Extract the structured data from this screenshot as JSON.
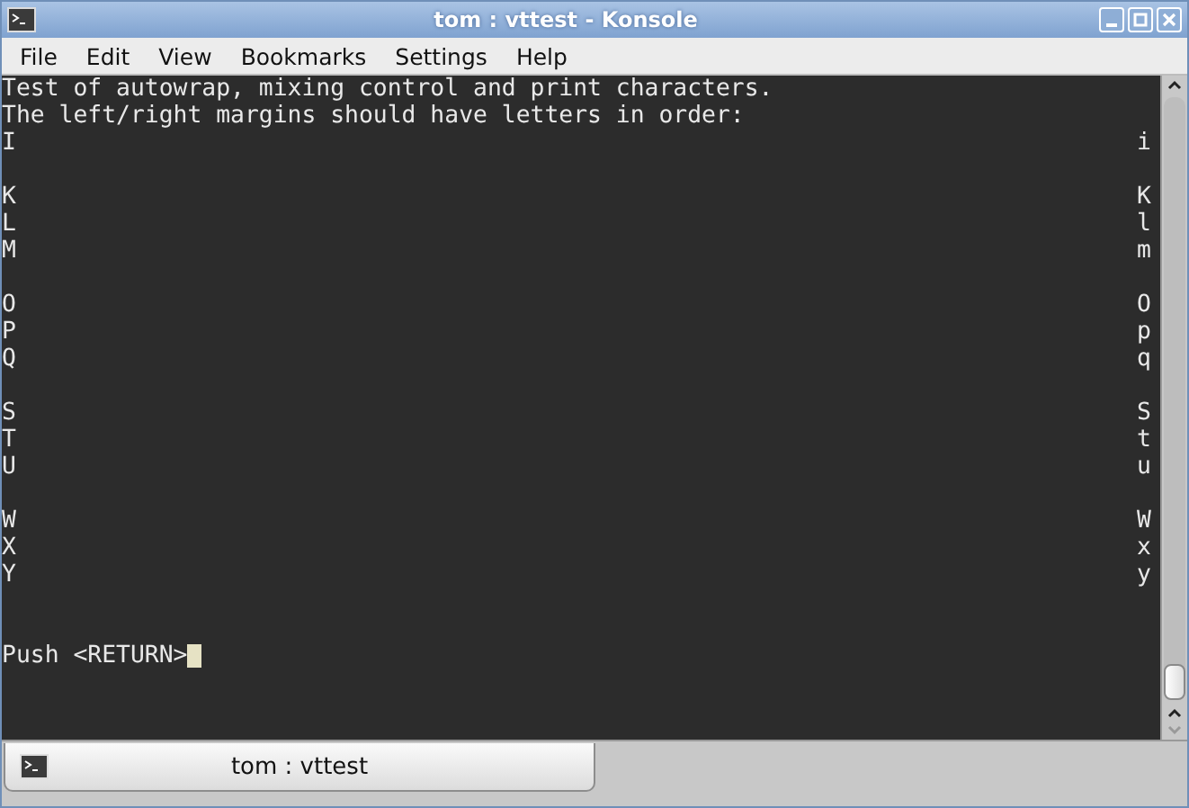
{
  "window": {
    "title": "tom : vttest - Konsole"
  },
  "menu": [
    "File",
    "Edit",
    "View",
    "Bookmarks",
    "Settings",
    "Help"
  ],
  "terminal": {
    "rows": [
      {
        "kind": "text",
        "left": "Test of autowrap, mixing control and print characters."
      },
      {
        "kind": "text",
        "left": "The left/right margins should have letters in order:"
      },
      {
        "kind": "text",
        "left": "I",
        "right": "i"
      },
      {
        "kind": "blank"
      },
      {
        "kind": "text",
        "left": "K",
        "right": "K"
      },
      {
        "kind": "text",
        "left": "L",
        "right": "l"
      },
      {
        "kind": "text",
        "left": "M",
        "right": "m"
      },
      {
        "kind": "blank"
      },
      {
        "kind": "text",
        "left": "O",
        "right": "O"
      },
      {
        "kind": "text",
        "left": "P",
        "right": "p"
      },
      {
        "kind": "text",
        "left": "Q",
        "right": "q"
      },
      {
        "kind": "blank"
      },
      {
        "kind": "text",
        "left": "S",
        "right": "S"
      },
      {
        "kind": "text",
        "left": "T",
        "right": "t"
      },
      {
        "kind": "text",
        "left": "U",
        "right": "u"
      },
      {
        "kind": "blank"
      },
      {
        "kind": "text",
        "left": "W",
        "right": "W"
      },
      {
        "kind": "text",
        "left": "X",
        "right": "x"
      },
      {
        "kind": "text",
        "left": "Y",
        "right": "y"
      },
      {
        "kind": "blank"
      },
      {
        "kind": "blank"
      },
      {
        "kind": "text",
        "left": "Push <RETURN>",
        "cursor": true
      }
    ]
  },
  "tabs": [
    {
      "label": "tom : vttest",
      "selected": true
    }
  ]
}
